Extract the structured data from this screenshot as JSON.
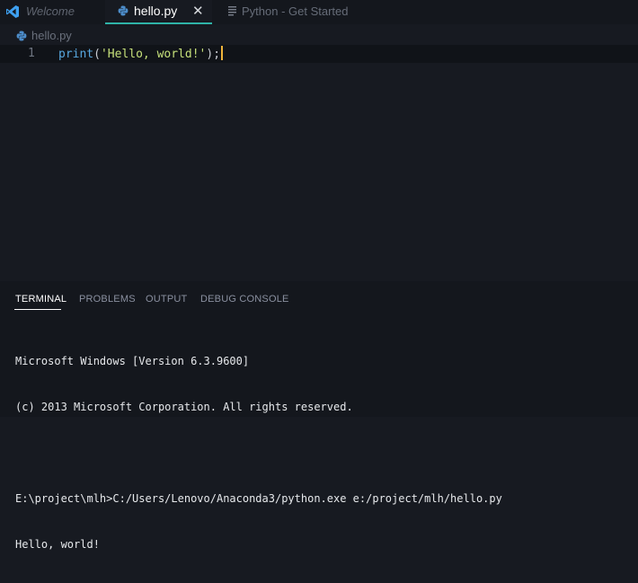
{
  "tabs": {
    "welcome": "Welcome",
    "active_file": "hello.py",
    "close_glyph": "✕",
    "get_started": "Python - Get Started"
  },
  "breadcrumb": {
    "file": "hello.py"
  },
  "editor": {
    "line_number": "1",
    "code": {
      "fn": "print",
      "open": "(",
      "string": "'Hello, world!'",
      "close": ");"
    }
  },
  "panel": {
    "tabs": [
      "TERMINAL",
      "PROBLEMS",
      "OUTPUT",
      "DEBUG CONSOLE"
    ],
    "active_tab": "TERMINAL",
    "terminal_lines": [
      "Microsoft Windows [Version 6.3.9600]",
      "(c) 2013 Microsoft Corporation. All rights reserved.",
      "",
      "E:\\project\\mlh>C:/Users/Lenovo/Anaconda3/python.exe e:/project/mlh/hello.py",
      "Hello, world!"
    ]
  },
  "colors": {
    "accent": "#2fb3a8",
    "vscode_blue": "#3ea0f0",
    "python_blue": "#4c8cc9",
    "string": "#c6e07a",
    "function": "#58a8e0",
    "cursor": "#f0b43a"
  },
  "icons": {
    "welcome_tab": "vscode-logo-icon",
    "file_tab": "python-file-icon",
    "started_tab": "document-lines-icon",
    "breadcrumb": "python-file-icon"
  }
}
